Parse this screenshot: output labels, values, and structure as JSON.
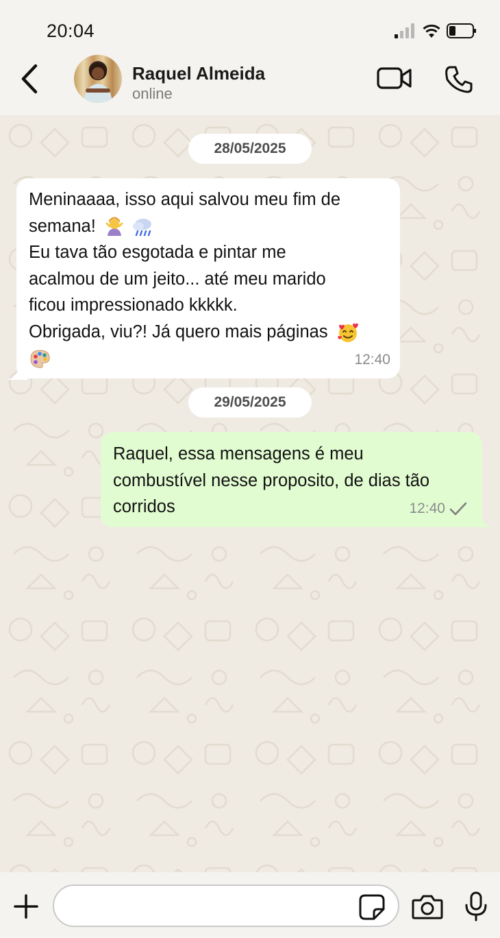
{
  "status_bar": {
    "time": "20:04"
  },
  "header": {
    "name": "Raquel Almeida",
    "status": "online"
  },
  "chat": {
    "dates": [
      "28/05/2025",
      "29/05/2025"
    ],
    "incoming": {
      "lines": [
        "Meninaaaa, isso aqui salvou meu fim de",
        "semana!",
        "Eu tava tão esgotada e pintar me",
        "acalmou de um jeito... até meu marido",
        "ficou impressionado kkkkk.",
        "Obrigada, viu?! Já quero mais páginas"
      ],
      "time": "12:40"
    },
    "outgoing": {
      "lines": [
        "Raquel, essa mensagens é meu",
        "combustível nesse proposito, de dias tão",
        "corridos"
      ],
      "time": "12:40"
    }
  },
  "input": {
    "placeholder": ""
  },
  "icons": {
    "back": "chevron-left-icon",
    "video": "video-call-icon",
    "call": "phone-icon",
    "add": "plus-icon",
    "sticker": "sticker-icon",
    "camera": "camera-icon",
    "mic": "microphone-icon"
  },
  "colors": {
    "outgoing_bubble": "#e2fcd2",
    "incoming_bubble": "#ffffff",
    "chat_background": "#efeae2"
  }
}
